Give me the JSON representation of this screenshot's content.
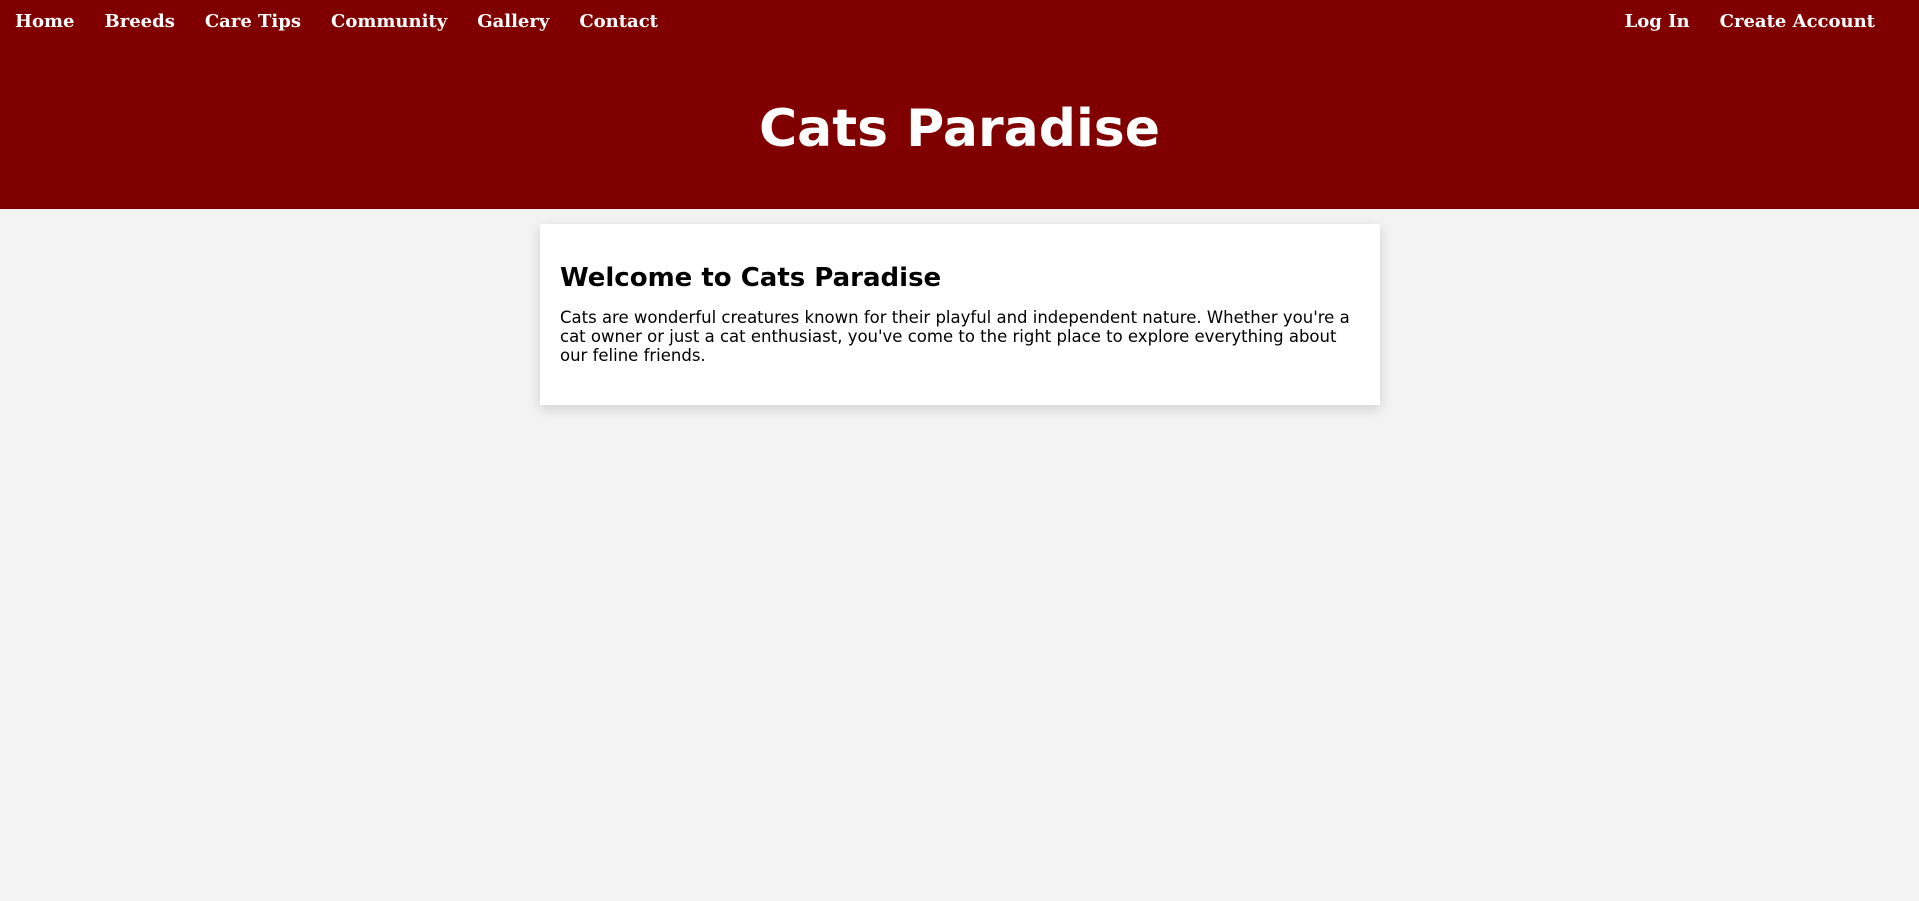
{
  "nav": {
    "left": [
      {
        "label": "Home"
      },
      {
        "label": "Breeds"
      },
      {
        "label": "Care Tips"
      },
      {
        "label": "Community"
      },
      {
        "label": "Gallery"
      },
      {
        "label": "Contact"
      }
    ],
    "right": [
      {
        "label": "Log In"
      },
      {
        "label": "Create Account"
      }
    ]
  },
  "header": {
    "title": "Cats Paradise"
  },
  "welcome": {
    "heading": "Welcome to Cats Paradise",
    "text": "Cats are wonderful creatures known for their playful and independent nature. Whether you're a cat owner or just a cat enthusiast, you've come to the right place to explore everything about our feline friends."
  },
  "colors": {
    "header_bg": "#800000",
    "page_bg": "#f3f3f3",
    "card_bg": "#ffffff",
    "nav_text": "#ffffff"
  }
}
